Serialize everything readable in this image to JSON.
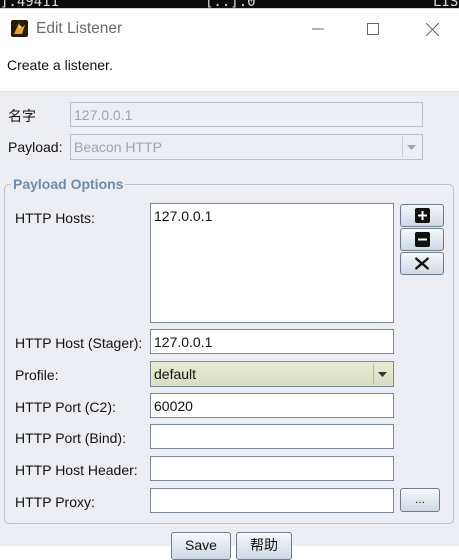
{
  "background": {
    "left_text": "].49411",
    "mid_text": "[..].0",
    "right_text": "LIS"
  },
  "window": {
    "title": "Edit Listener",
    "icon": "app-logo-icon"
  },
  "description": "Create a listener.",
  "form": {
    "name_label": "名字",
    "name_value": "127.0.0.1",
    "payload_label": "Payload:",
    "payload_value": "Beacon HTTP"
  },
  "options": {
    "group_title": "Payload Options",
    "hosts_label": "HTTP Hosts:",
    "hosts": [
      "127.0.0.1"
    ],
    "add_icon": "plus-icon",
    "remove_icon": "minus-icon",
    "clear_icon": "x-icon",
    "stager_label": "HTTP Host (Stager):",
    "stager_value": "127.0.0.1",
    "profile_label": "Profile:",
    "profile_value": "default",
    "port_c2_label": "HTTP Port (C2):",
    "port_c2_value": "60020",
    "port_bind_label": "HTTP Port (Bind):",
    "port_bind_value": "",
    "host_header_label": "HTTP Host Header:",
    "host_header_value": "",
    "proxy_label": "HTTP Proxy:",
    "proxy_value": "",
    "proxy_button": "..."
  },
  "buttons": {
    "save": "Save",
    "help": "帮助"
  }
}
